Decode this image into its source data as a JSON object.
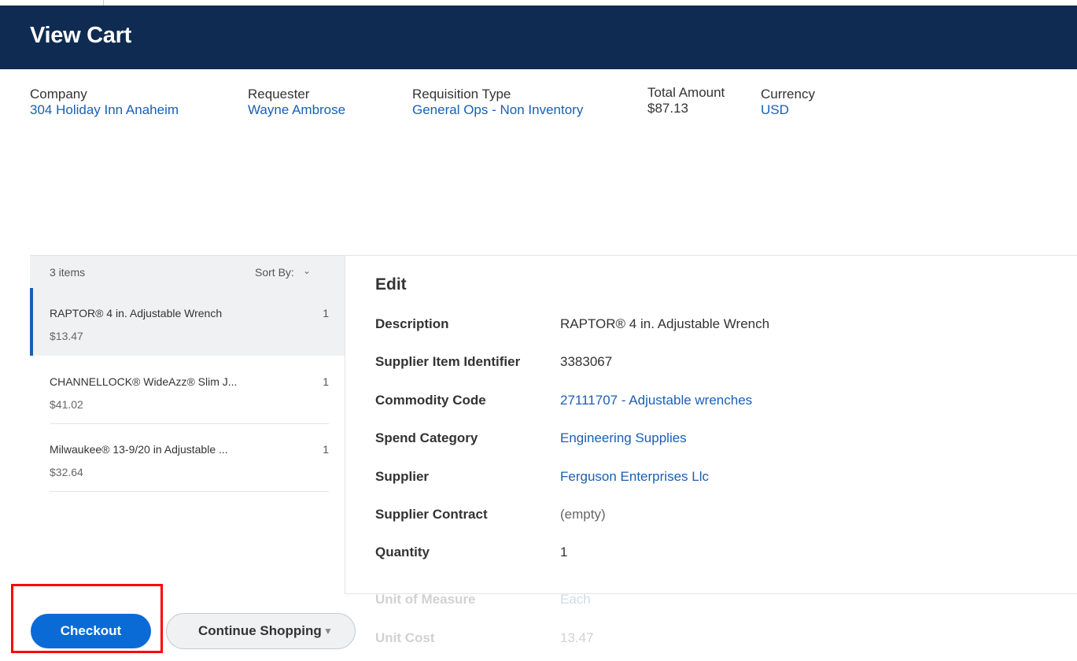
{
  "header": {
    "title": "View Cart"
  },
  "summary": {
    "company": {
      "label": "Company",
      "value": "304 Holiday Inn Anaheim"
    },
    "requester": {
      "label": "Requester",
      "value": "Wayne Ambrose"
    },
    "requisition_type": {
      "label": "Requisition Type",
      "value": "General Ops - Non Inventory"
    },
    "total_amount": {
      "label": "Total Amount",
      "value": "$87.13"
    },
    "currency": {
      "label": "Currency",
      "value": "USD"
    }
  },
  "cart_list": {
    "count": "3 items",
    "sort_label": "Sort By:",
    "items": [
      {
        "name": "RAPTOR® 4 in. Adjustable Wrench",
        "qty": "1",
        "price": "$13.47"
      },
      {
        "name": "CHANNELLOCK® WideAzz® Slim J...",
        "qty": "1",
        "price": "$41.02"
      },
      {
        "name": "Milwaukee® 13-9/20 in Adjustable ...",
        "qty": "1",
        "price": "$32.64"
      }
    ]
  },
  "edit": {
    "title": "Edit",
    "fields": [
      {
        "label": "Description",
        "value": "RAPTOR® 4 in. Adjustable Wrench"
      },
      {
        "label": "Supplier Item Identifier",
        "value": "3383067"
      },
      {
        "label": "Commodity Code",
        "value": "27111707 - Adjustable wrenches"
      },
      {
        "label": "Spend Category",
        "value": "Engineering Supplies"
      },
      {
        "label": "Supplier",
        "value": "Ferguson Enterprises Llc"
      },
      {
        "label": "Supplier Contract",
        "value": "(empty)"
      },
      {
        "label": "Quantity",
        "value": "1"
      },
      {
        "label": "Unit of Measure",
        "value": "Each"
      },
      {
        "label": "Unit Cost",
        "value": "13.47"
      }
    ]
  },
  "footer": {
    "checkout_label": "Checkout",
    "continue_label": "Continue Shopping"
  },
  "icons": {
    "sort": "chevron-down-icon",
    "continue": "caret-down-icon"
  },
  "colors": {
    "header_bg": "#0f2b52",
    "link": "#1a5fb4",
    "primary_button": "#0a6bd6",
    "highlight": "#ff0000"
  }
}
